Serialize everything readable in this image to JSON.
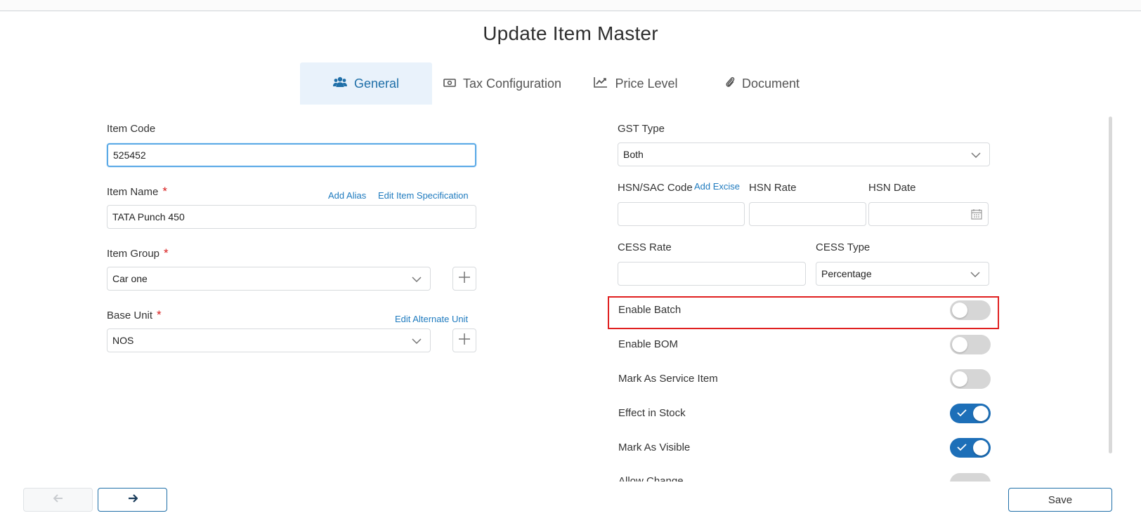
{
  "page": {
    "title": "Update Item Master"
  },
  "tabs": [
    {
      "label": "General",
      "icon": "users-icon",
      "active": true
    },
    {
      "label": "Tax Configuration",
      "icon": "money-icon",
      "active": false
    },
    {
      "label": "Price Level",
      "icon": "line-chart-icon",
      "active": false
    },
    {
      "label": "Document",
      "icon": "paperclip-icon",
      "active": false
    }
  ],
  "left": {
    "item_code": {
      "label": "Item Code",
      "value": "525452"
    },
    "item_name": {
      "label": "Item Name",
      "required": "*",
      "value": "TATA Punch 450",
      "add_alias": "Add Alias",
      "edit_spec": "Edit Item Specification"
    },
    "item_group": {
      "label": "Item Group",
      "required": "*",
      "value": "Car one"
    },
    "base_unit": {
      "label": "Base Unit",
      "required": "*",
      "value": "NOS",
      "edit_alt_unit": "Edit Alternate Unit"
    }
  },
  "right": {
    "gst_type": {
      "label": "GST Type",
      "value": "Both"
    },
    "hsn_sac": {
      "label": "HSN/SAC Code",
      "add_excise": "Add Excise",
      "value": ""
    },
    "hsn_rate": {
      "label": "HSN Rate",
      "value": ""
    },
    "hsn_date": {
      "label": "HSN Date",
      "value": ""
    },
    "cess_rate": {
      "label": "CESS Rate",
      "value": ""
    },
    "cess_type": {
      "label": "CESS Type",
      "value": "Percentage"
    },
    "toggles": [
      {
        "label": "Enable Batch",
        "on": false
      },
      {
        "label": "Enable BOM",
        "on": false
      },
      {
        "label": "Mark As Service Item",
        "on": false
      },
      {
        "label": "Effect in Stock",
        "on": true
      },
      {
        "label": "Mark As Visible",
        "on": true
      }
    ],
    "cut_off_label": "Allow Change"
  },
  "footer": {
    "save_label": "Save"
  },
  "colors": {
    "accent": "#1f6fa8",
    "link": "#1f7bbf",
    "required": "#d81b1b",
    "highlight": "#e02020",
    "toggle_on": "#1d6fb8",
    "toggle_off": "#d6d6d6"
  }
}
